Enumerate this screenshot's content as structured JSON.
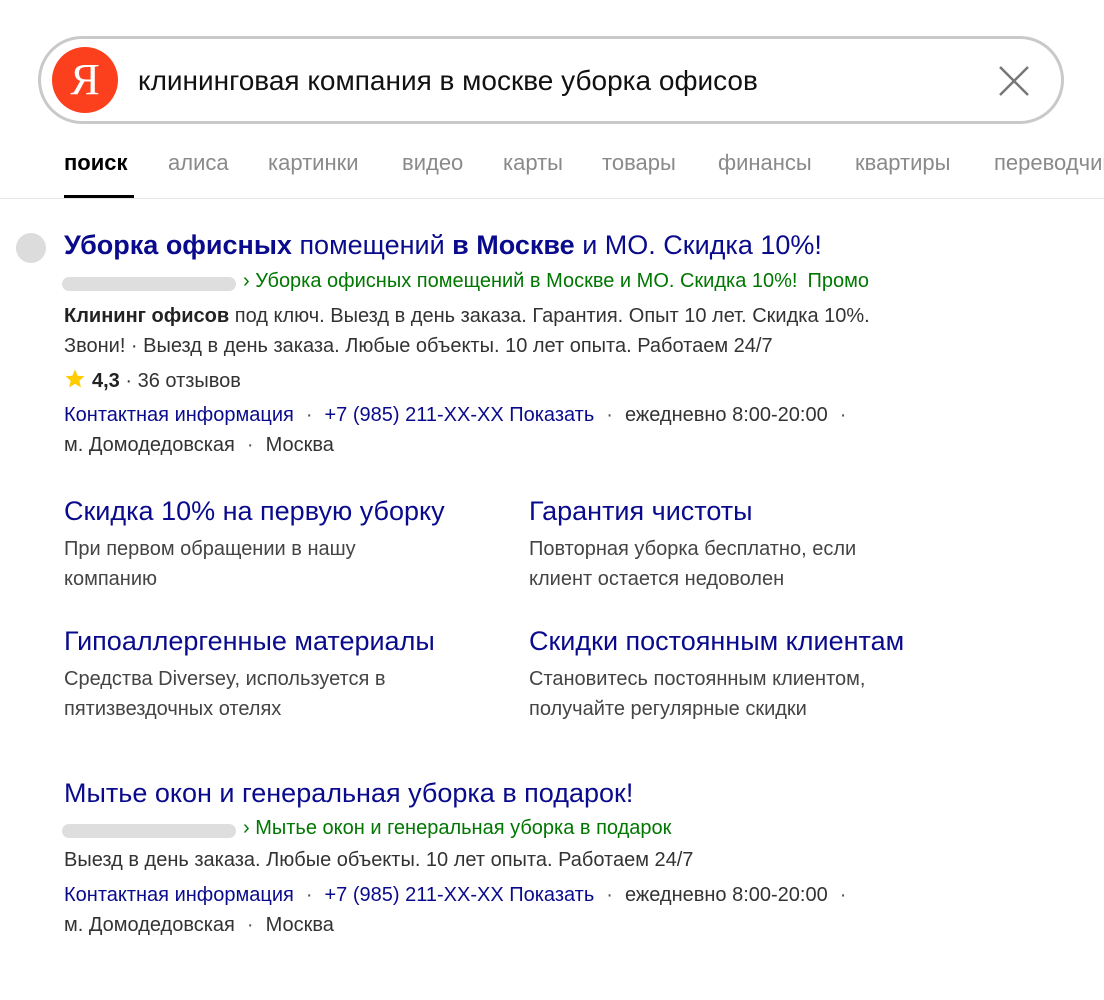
{
  "search": {
    "logo_letter": "Я",
    "query": "клининговая компания в москве уборка офисов"
  },
  "tabs": [
    "поиск",
    "алиса",
    "картинки",
    "видео",
    "карты",
    "товары",
    "финансы",
    "квартиры",
    "переводчик"
  ],
  "ad1": {
    "title_parts": [
      "Уборка офисных",
      " помещений ",
      "в Москве",
      " и МО. Скидка 10%!"
    ],
    "url_text": "› Уборка офисных помещений в Москве и МО. Скидка 10%!",
    "promo_label": "Промо",
    "desc_bold": "Клининг офисов",
    "desc_line1_rest": " под ключ. Выезд в день заказа. Гарантия. Опыт 10 лет. Скидка 10%.",
    "desc_line2": "Звони! · Выезд в день заказа. Любые объекты. 10 лет опыта. Работаем 24/7",
    "rating_score": "4,3",
    "rating_reviews": "· 36 отзывов",
    "contact_link": "Контактная информация",
    "phone": "+7 (985) 211-XX-XX",
    "show_label": "Показать",
    "hours": "ежедневно 8:00-20:00",
    "metro": "м. Домодедовская",
    "city": "Москва"
  },
  "sitelinks": [
    {
      "title": "Скидка 10% на первую уборку",
      "desc1": "При первом обращении в нашу",
      "desc2": "компанию"
    },
    {
      "title": "Гарантия чистоты",
      "desc1": "Повторная уборка бесплатно, если",
      "desc2": "клиент остается недоволен"
    },
    {
      "title": "Гипоаллергенные материалы",
      "desc1": "Средства Diversey, используется в",
      "desc2": "пятизвездочных отелях"
    },
    {
      "title": "Скидки постоянным клиентам",
      "desc1": "Становитесь постоянным клиентом,",
      "desc2": "получайте регулярные скидки"
    }
  ],
  "ad2": {
    "title": "Мытье окон и генеральная уборка в подарок!",
    "url_text": "› Мытье окон и генеральная уборка в подарок",
    "desc": "Выезд в день заказа. Любые объекты. 10 лет опыта. Работаем 24/7",
    "contact_link": "Контактная информация",
    "phone": "+7 (985) 211-XX-XX",
    "show_label": "Показать",
    "hours": "ежедневно 8:00-20:00",
    "metro": "м. Домодедовская",
    "city": "Москва"
  },
  "colors": {
    "link": "#0a0b8c",
    "url": "#007700",
    "logo": "#fc3f1d",
    "star": "#ffcc00"
  },
  "icons": {
    "clear": "close-icon",
    "star": "star-icon"
  }
}
